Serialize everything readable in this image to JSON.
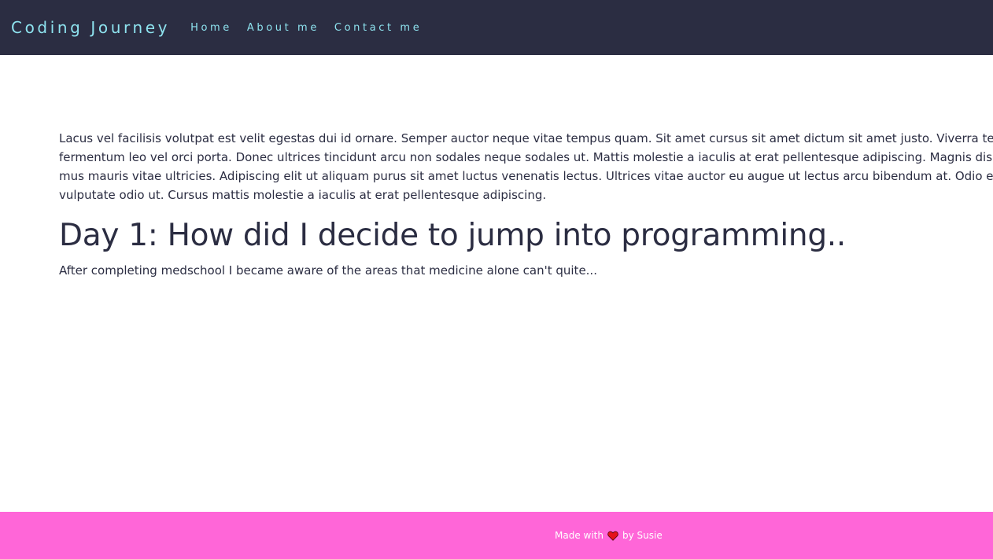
{
  "navbar": {
    "brand": "Coding Journey",
    "links": [
      "Home",
      "About me",
      "Contact me"
    ]
  },
  "main": {
    "intro_lines": [
      "Lacus vel facilisis volutpat est velit egestas dui id ornare. Semper auctor neque vitae tempus quam. Sit amet cursus sit amet dictum sit amet justo. Viverra tellus in hac habitasse",
      "fermentum leo vel orci porta. Donec ultrices tincidunt arcu non sodales neque sodales ut. Mattis molestie a iaculis at erat pellentesque adipiscing. Magnis dis parturient montes nascetur",
      "mus mauris vitae ultricies. Adipiscing elit ut aliquam purus sit amet luctus venenatis lectus. Ultrices vitae auctor eu augue ut lectus arcu bibendum at. Odio euismod lacinia at quis",
      "vulputate odio ut. Cursus mattis molestie a iaculis at erat pellentesque adipiscing."
    ],
    "post_title": "Day 1: How did I decide to jump into programming..",
    "post_excerpt": "After completing medschool I became aware of the areas that medicine alone can't quite..."
  },
  "footer": {
    "made_with": "Made with",
    "by": "by Susie",
    "icon": "heart-icon"
  },
  "colors": {
    "navbar_bg": "#2b2d42",
    "nav_text": "#8ee3ef",
    "body_text": "#2b2d42",
    "footer_bg": "#ff66d8",
    "heart": "#e5121b"
  }
}
